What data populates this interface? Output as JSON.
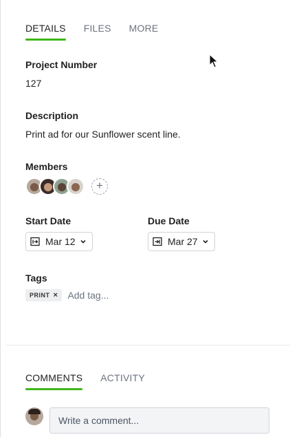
{
  "tabs": [
    {
      "label": "DETAILS",
      "active": true
    },
    {
      "label": "FILES",
      "active": false
    },
    {
      "label": "MORE",
      "active": false
    }
  ],
  "project_number": {
    "label": "Project Number",
    "value": "127"
  },
  "description": {
    "label": "Description",
    "value": "Print ad for our Sunflower scent line."
  },
  "members": {
    "label": "Members",
    "count": 4,
    "add_icon": "plus-circle-icon"
  },
  "start_date": {
    "label": "Start Date",
    "value": "Mar 12",
    "icon": "calendar-start-icon"
  },
  "due_date": {
    "label": "Due Date",
    "value": "Mar 27",
    "icon": "calendar-end-icon"
  },
  "tags": {
    "label": "Tags",
    "items": [
      {
        "label": "PRINT",
        "remove": "×"
      }
    ],
    "add_placeholder": "Add tag..."
  },
  "comment_tabs": [
    {
      "label": "COMMENTS",
      "active": true
    },
    {
      "label": "ACTIVITY",
      "active": false
    }
  ],
  "comment": {
    "placeholder": "Write a comment..."
  },
  "colors": {
    "accent": "#3fb618",
    "text": "#1f1f1f",
    "muted": "#6b7280",
    "border": "#cfd3d8"
  }
}
